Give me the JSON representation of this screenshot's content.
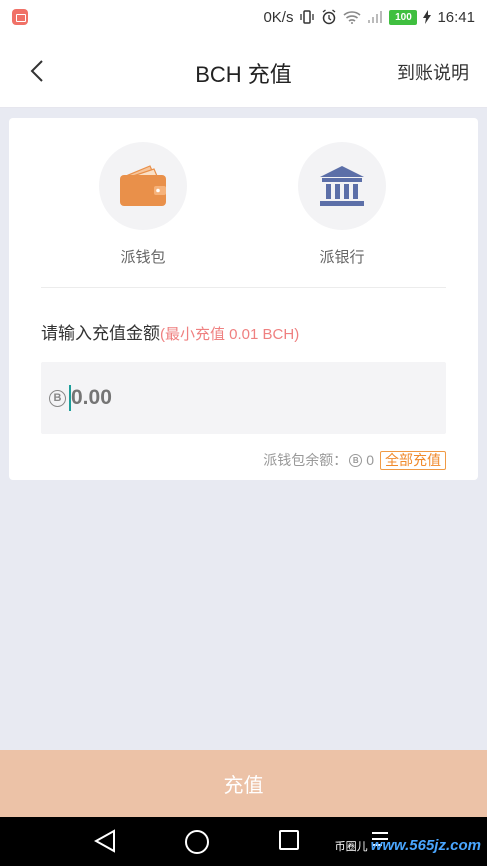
{
  "status_bar": {
    "speed": "0K/s",
    "battery": "100",
    "time": "16:41"
  },
  "header": {
    "title": "BCH 充值",
    "help": "到账说明"
  },
  "options": [
    {
      "label": "派钱包",
      "icon": "wallet-icon"
    },
    {
      "label": "派银行",
      "icon": "bank-icon"
    }
  ],
  "amount": {
    "label": "请输入充值金额",
    "hint": "(最小充值 0.01 BCH)",
    "placeholder": "0.00",
    "currency_symbol": "B"
  },
  "balance": {
    "label": "派钱包余额：",
    "value": "0",
    "all_button": "全部充值"
  },
  "submit": "充值",
  "watermark": {
    "badge": "币圈儿",
    "site": "www.565jz.com"
  },
  "colors": {
    "accent": "#f08a2c",
    "submit_bg": "#ecc2a7",
    "hint": "#ef8080",
    "wallet": "#e9904a",
    "bank": "#5c6fa8"
  }
}
